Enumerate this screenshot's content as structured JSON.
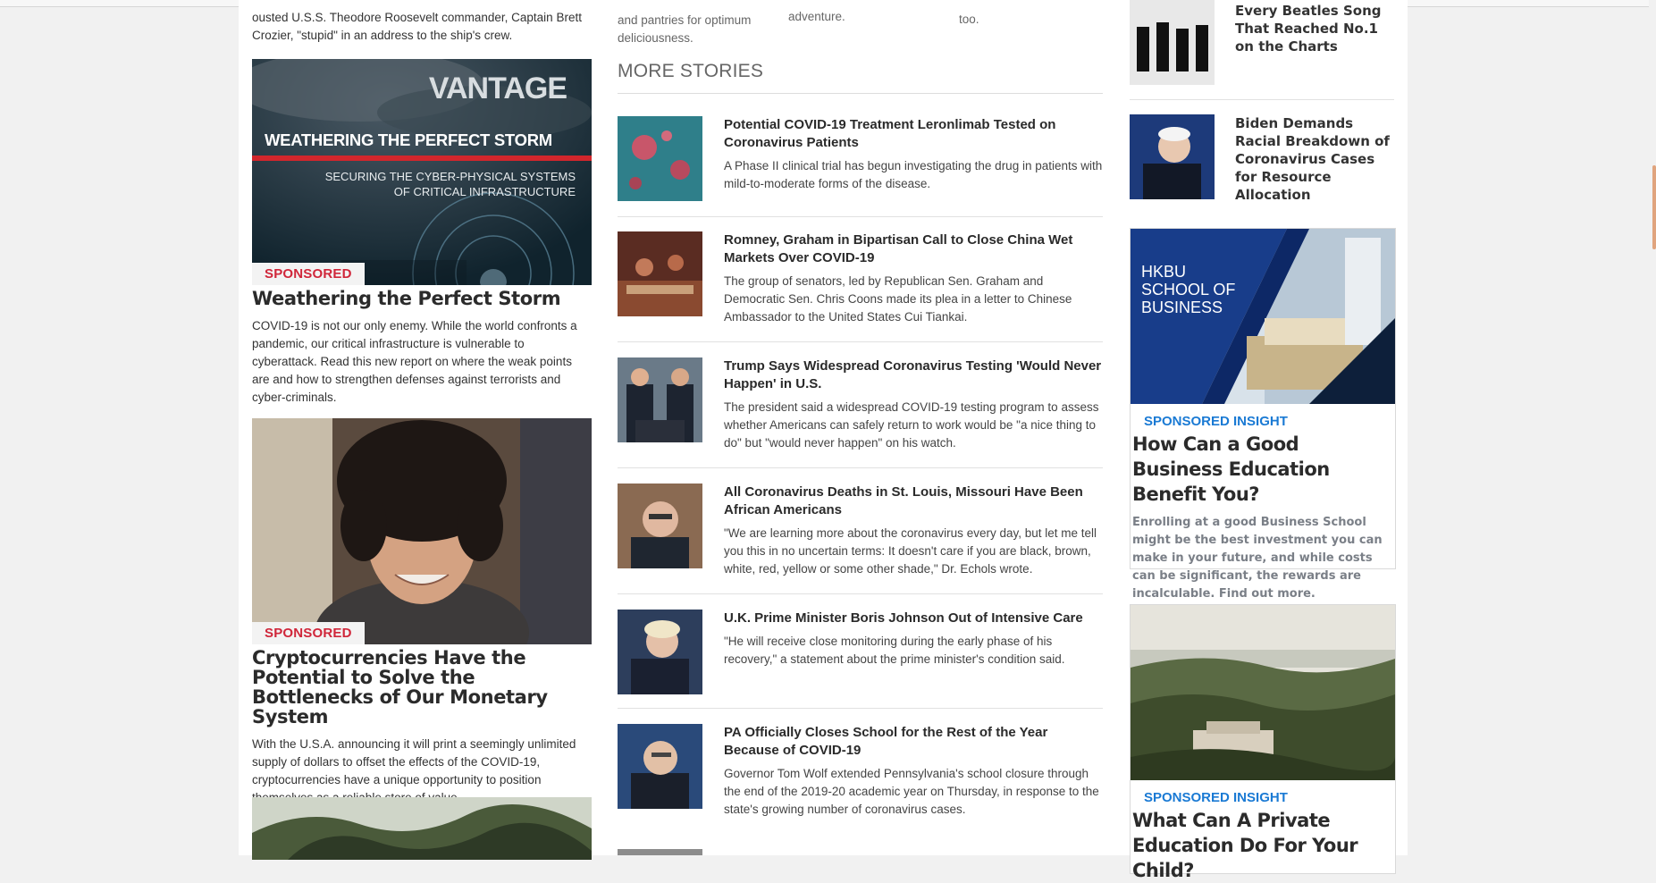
{
  "left": {
    "top_snippet": "ousted U.S.S. Theodore Roosevelt commander, Captain Brett Crozier, \"stupid\" in an address to the ship's crew.",
    "cards": [
      {
        "image_text": {
          "brand": "VANTAGE",
          "headline": "WEATHERING THE PERFECT STORM",
          "sub1": "SECURING THE CYBER-PHYSICAL SYSTEMS",
          "sub2": "OF CRITICAL INFRASTRUCTURE"
        },
        "label": "SPONSORED",
        "title": "Weathering the Perfect Storm",
        "desc": "COVID-19 is not our only enemy. While the world confronts a pandemic, our critical infrastructure is vulnerable to cyberattack. Read this new report on where the weak points are and how to strengthen defenses against terrorists and cyber-criminals."
      },
      {
        "label": "SPONSORED",
        "title": "Cryptocurrencies Have the Potential to Solve the Bottlenecks of Our Monetary System",
        "desc": "With the U.S.A. announcing it will print a seemingly unlimited supply of dollars to offset the effects of the COVID-19, cryptocurrencies have a unique opportunity to position themselves as a reliable store of value."
      }
    ]
  },
  "middle": {
    "snippets": [
      "and pantries for optimum deliciousness.",
      "adventure.",
      "too."
    ],
    "section_title": "MORE STORIES",
    "stories": [
      {
        "title": "Potential COVID-19 Treatment Leronlimab Tested on Coronavirus Patients",
        "desc": "A Phase II clinical trial has begun investigating the drug in patients with mild-to-moderate forms of the disease."
      },
      {
        "title": "Romney, Graham in Bipartisan Call to Close China Wet Markets Over COVID-19",
        "desc": "The group of senators, led by Republican Sen. Graham and Democratic Sen. Chris Coons made its plea in a letter to Chinese Ambassador to the United States Cui Tiankai."
      },
      {
        "title": "Trump Says Widespread Coronavirus Testing 'Would Never Happen' in U.S.",
        "desc": "The president said a widespread COVID-19 testing program to assess whether Americans can safely return to work would be \"a nice thing to do\" but \"would never happen\" on his watch."
      },
      {
        "title": "All Coronavirus Deaths in St. Louis, Missouri Have Been African Americans",
        "desc": "\"We are learning more about the coronavirus every day, but let me tell you this in no uncertain terms: It doesn't care if you are black, brown, white, red, yellow or some other shade,\" Dr. Echols wrote."
      },
      {
        "title": "U.K. Prime Minister Boris Johnson Out of Intensive Care",
        "desc": "\"He will receive close monitoring during the early phase of his recovery,\" a statement about the prime minister's condition said."
      },
      {
        "title": "PA Officially Closes School for the Rest of the Year Because of COVID-19",
        "desc": "Governor Tom Wolf extended Pennsylvania's school closure through the end of the 2019-20 academic year on Thursday, in response to the state's growing number of coronavirus cases."
      }
    ]
  },
  "right": {
    "items": [
      {
        "title": "Every Beatles Song That Reached No.1 on the Charts"
      },
      {
        "title": "Biden Demands Racial Breakdown of Coronavirus Cases for Resource Allocation"
      }
    ],
    "insights": [
      {
        "image_text": {
          "line1": "HKBU",
          "line2": "SCHOOL OF",
          "line3": "BUSINESS"
        },
        "label": "SPONSORED INSIGHT",
        "title": "How Can a Good Business Education Benefit You?",
        "desc": "Enrolling at a good Business School might be the best investment you can make in your future, and while costs can be significant, the rewards are incalculable. Find out more."
      },
      {
        "label": "SPONSORED INSIGHT",
        "title": "What Can A Private Education Do For Your Child?"
      }
    ]
  }
}
